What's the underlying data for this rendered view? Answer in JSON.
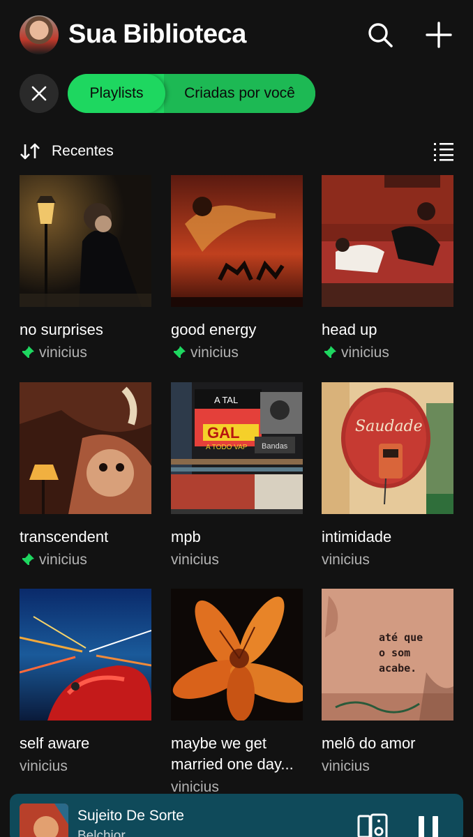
{
  "header": {
    "title": "Sua Biblioteca",
    "icons": {
      "avatar": "user-avatar",
      "search": "search-icon",
      "add": "plus-icon"
    }
  },
  "filters": {
    "clear_icon": "close-icon",
    "chips": [
      {
        "label": "Playlists",
        "selected": true
      },
      {
        "label": "Criadas por você",
        "selected": true
      }
    ],
    "accent": "#1ed760"
  },
  "sort": {
    "label": "Recentes",
    "icon": "sort-arrows-icon",
    "view_icon": "list-view-icon"
  },
  "playlists": [
    {
      "title": "no surprises",
      "owner": "vinicius",
      "pinned": true
    },
    {
      "title": "good energy",
      "owner": "vinicius",
      "pinned": true
    },
    {
      "title": "head up",
      "owner": "vinicius",
      "pinned": true
    },
    {
      "title": "transcendent",
      "owner": "vinicius",
      "pinned": true
    },
    {
      "title": "mpb",
      "owner": "vinicius",
      "pinned": false
    },
    {
      "title": "intimidade",
      "owner": "vinicius",
      "pinned": false
    },
    {
      "title": "self aware",
      "owner": "vinicius",
      "pinned": false
    },
    {
      "title": "maybe we get married one day...",
      "owner": "vinicius",
      "pinned": false
    },
    {
      "title": "melô do amor",
      "owner": "vinicius",
      "pinned": false
    }
  ],
  "cover_text": {
    "mpb_record_top": "A TAL",
    "mpb_record_main": "GAL",
    "mpb_record_sub": "A TODO VAP",
    "mpb_sign": "Bandas",
    "intimidade_sign": "Saudade",
    "melo_graffiti": [
      "até que",
      "o som",
      "acabe."
    ]
  },
  "now_playing": {
    "title": "Sujeito De Sorte",
    "artist": "Belchior",
    "icons": {
      "devices": "devices-icon",
      "pause": "pause-icon"
    },
    "background": "#0f4a5a"
  }
}
